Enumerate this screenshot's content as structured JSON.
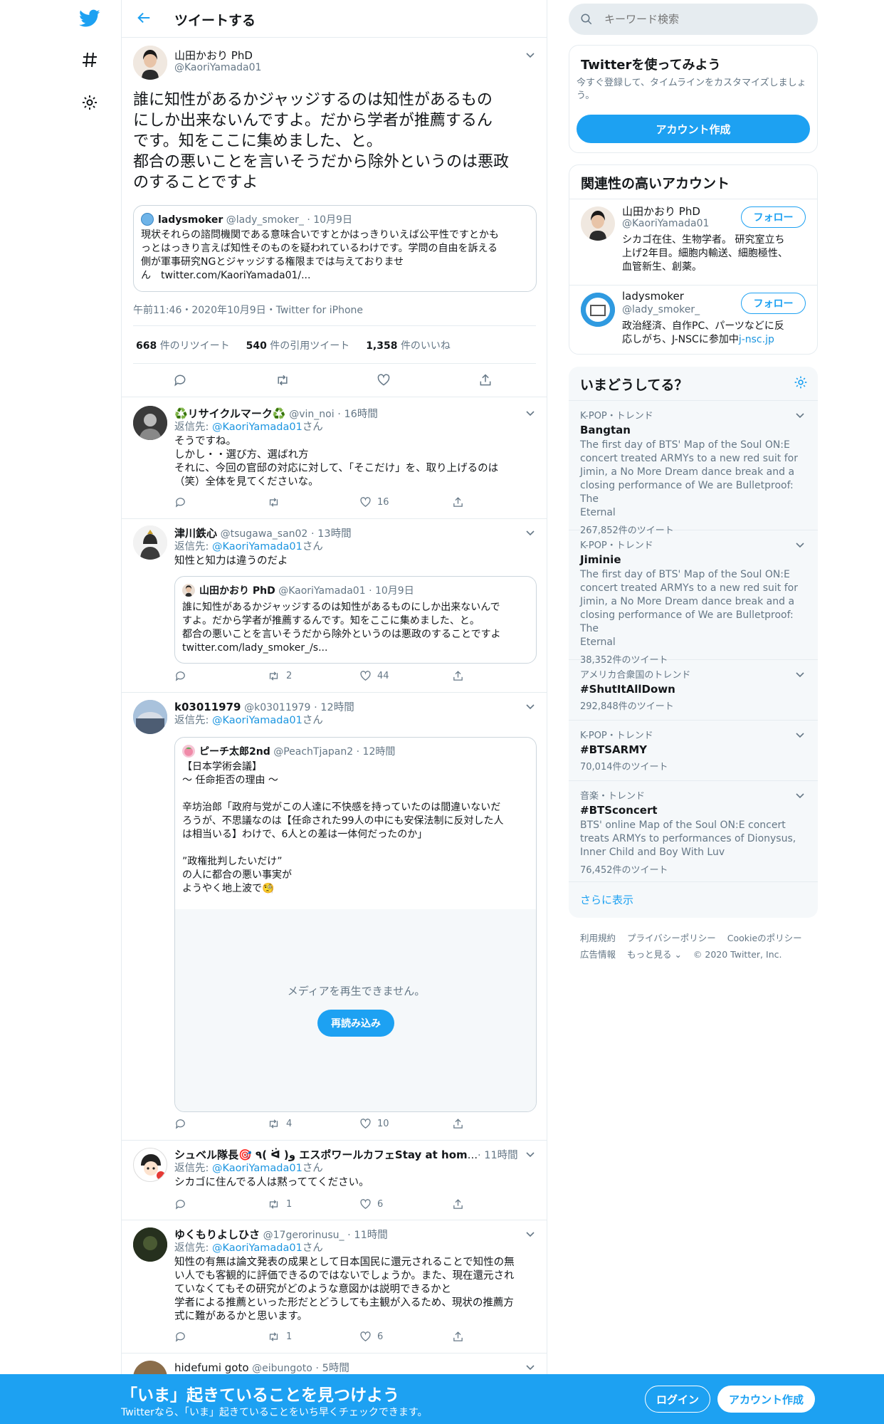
{
  "header": {
    "title": "ツイートする"
  },
  "main_tweet": {
    "name": "山田かおり PhD",
    "handle": "@KaoriYamada01",
    "text_lines": [
      "誰に知性があるかジャッジするのは知性があるもの",
      "にしか出来ないんですよ。だから学者が推薦するん",
      "です。知をここに集めました、と。",
      "都合の悪いことを言いそうだから除外というのは悪政",
      "のすることですよ"
    ],
    "quote": {
      "name": "ladysmoker",
      "handle": "@lady_smoker_",
      "date": "10月9日",
      "text_lines": [
        "現状それらの諮問機関である意味合いですとかはっきりいえば公平性ですとかも",
        "っとはっきり言えば知性そのものを疑われているわけです。学問の自由を訴える",
        "側が軍事研究NGとジャッジする権限までは与えておりませ",
        "ん　twitter.com/KaoriYamada01/..."
      ]
    },
    "meta": "午前11:46・2020年10月9日・Twitter for iPhone",
    "retweets": "668",
    "retweets_label": "件のリツイート",
    "quote_tweets": "540",
    "quote_tweets_label": "件の引用ツイート",
    "likes": "1,358",
    "likes_label": "件のいいね"
  },
  "replies": [
    {
      "name": "♻️リサイクルマーク♻️",
      "handle": "@vin_noi",
      "time": "16時間",
      "reply_to": "@KaoriYamada01",
      "text_lines": [
        "そうですね。",
        "しかし・・選び方、選ばれ方",
        "それに、今回の官邸の対応に対して、「そこだけ」を、取り上げるのは",
        "（笑）全体を見てくださいな。"
      ],
      "retweets": "",
      "likes": "16"
    },
    {
      "name": "津川鉄心",
      "handle": "@tsugawa_san02",
      "time": "13時間",
      "reply_to": "@KaoriYamada01",
      "text_lines": [
        "知性と知力は違うのだよ"
      ],
      "retweets": "2",
      "likes": "44",
      "quote": {
        "name": "山田かおり PhD",
        "handle": "@KaoriYamada01",
        "date": "10月9日",
        "text_lines": [
          "誰に知性があるかジャッジするのは知性があるものにしか出来ないんで",
          "すよ。だから学者が推薦するんです。知をここに集めました、と。",
          "都合の悪いことを言いそうだから除外というのは悪政のすることですよ",
          "twitter.com/lady_smoker_/s..."
        ]
      }
    },
    {
      "name": "k03011979",
      "handle": "@k03011979",
      "time": "12時間",
      "reply_to": "@KaoriYamada01",
      "text_lines": [],
      "retweets": "4",
      "likes": "10",
      "quote": {
        "name": "ピーチ太郎2nd",
        "handle": "@PeachTjapan2",
        "date": "12時間",
        "text_lines": [
          "【日本学術会議】",
          "～ 任命拒否の理由 ～",
          "",
          "辛坊治郎「政府与党がこの人達に不快感を持っていたのは間違いないだ",
          "ろうが、不思議なのは【任命された99人の中にも安保法制に反対した人",
          "は相当いる】わけで、6人との差は一体何だったのか」",
          "",
          "”政権批判したいだけ”",
          "の人に都合の悪い事実が",
          "ようやく地上波で🧐"
        ],
        "media_error": "メディアを再生できません。",
        "reload": "再読み込み"
      }
    },
    {
      "name": "シュベル隊長🎯 ٩( ᐛ )و エスポワールカフェStay at home",
      "handle": "@...",
      "time": "11時間",
      "reply_to": "@KaoriYamada01",
      "text_lines": [
        "シカゴに住んでる人は黙っててください。"
      ],
      "retweets": "1",
      "likes": "6"
    },
    {
      "name": "ゆくもりよしひさ",
      "handle": "@17gerorinusu_",
      "time": "11時間",
      "reply_to": "@KaoriYamada01",
      "text_lines": [
        "知性の有無は論文発表の成果として日本国民に還元されることで知性の無",
        "い人でも客観的に評価できるのではないでしょうか。また、現在還元され",
        "ていなくてもその研究がどのような意図かは説明できるかと",
        "学者による推薦といった形だとどうしても主観が入るため、現状の推薦方",
        "式に難があるかと思います。"
      ],
      "retweets": "1",
      "likes": "6"
    },
    {
      "name": "hidefumi goto",
      "handle": "@eibungoto",
      "time": "5時間",
      "reply_to": "",
      "text_lines": [],
      "retweets": "",
      "likes": ""
    }
  ],
  "reply_prefix": "返信先: ",
  "reply_suffix": "さん",
  "search": {
    "placeholder": "キーワード検索"
  },
  "signup_card": {
    "title": "Twitterを使ってみよう",
    "desc_lines": [
      "今すぐ登録して、タイムラインをカスタマイズしましょ",
      "う。"
    ],
    "button": "アカウント作成"
  },
  "related": {
    "title": "関連性の高いアカウント",
    "follow": "フォロー",
    "accounts": [
      {
        "name": "山田かおり PhD",
        "handle": "@KaoriYamada01",
        "bio_lines": [
          "シカゴ在住、生物学者。 研究室立ち",
          "上げ2年目。細胞内輸送、細胞極性、",
          "血管新生、創薬。"
        ],
        "link": ""
      },
      {
        "name": "ladysmoker",
        "handle": "@lady_smoker_",
        "bio_lines": [
          "政治経済、自作PC、パーツなどに反",
          "応しがち、J-NSCに参加中"
        ],
        "link": "j-nsc.jp"
      }
    ]
  },
  "trends": {
    "title": "いまどうしてる？",
    "items": [
      {
        "meta": "K-POP・トレンド",
        "name": "Bangtan",
        "desc_lines": [
          "The first day of BTS' Map of the Soul ON:E",
          "concert treated ARMYs to a new red suit for",
          "Jimin, a No More Dream dance break and a",
          "closing performance of We are Bulletproof: The",
          "Eternal"
        ],
        "count": "267,852件のツイート"
      },
      {
        "meta": "K-POP・トレンド",
        "name": "Jiminie",
        "desc_lines": [
          "The first day of BTS' Map of the Soul ON:E",
          "concert treated ARMYs to a new red suit for",
          "Jimin, a No More Dream dance break and a",
          "closing performance of We are Bulletproof: The",
          "Eternal"
        ],
        "count": "38,352件のツイート"
      },
      {
        "meta": "アメリカ合衆国のトレンド",
        "name": "#ShutItAllDown",
        "desc_lines": [],
        "count": "292,848件のツイート"
      },
      {
        "meta": "K-POP・トレンド",
        "name": "#BTSARMY",
        "desc_lines": [],
        "count": "70,014件のツイート"
      },
      {
        "meta": "音楽・トレンド",
        "name": "#BTSconcert",
        "desc_lines": [
          "BTS' online Map of the Soul ON:E concert",
          "treats ARMYs to performances of Dionysus,",
          "Inner Child and Boy With Luv"
        ],
        "count": "76,452件のツイート"
      }
    ],
    "show_more": "さらに表示"
  },
  "footer": {
    "links_row1": [
      "利用規約",
      "プライバシーポリシー",
      "Cookieのポリシー"
    ],
    "links_row2": [
      "広告情報",
      "もっと見る ⌄"
    ],
    "copyright": "© 2020 Twitter, Inc."
  },
  "banner": {
    "title": "「いま」起きていることを見つけよう",
    "subtitle": "Twitterなら、「いま」起きていることをいち早くチェックできます。",
    "login": "ログイン",
    "signup": "アカウント作成"
  },
  "colors": {
    "accent": "#1da1f2",
    "link": "#1b95e0",
    "muted": "#657786",
    "border": "#e6ecf0"
  }
}
